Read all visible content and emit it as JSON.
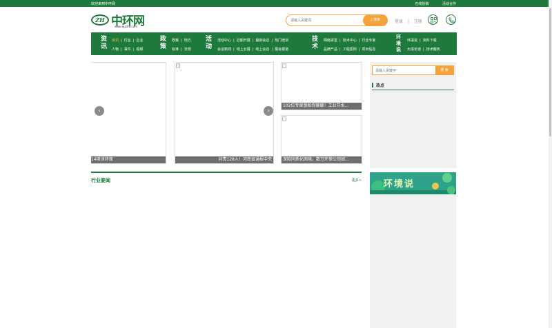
{
  "topbar": {
    "welcome": "欢迎来到中环网",
    "links": [
      "在线投稿",
      "活动合作"
    ]
  },
  "logo": {
    "badge": "ZH",
    "name": "中环网",
    "url": "www.epzhw.com"
  },
  "header": {
    "search_placeholder": "请输入关键词",
    "search_button": "搜索",
    "login": "登录",
    "divider": "|",
    "register": "注册",
    "icons": [
      "qr-code-icon",
      "phone-icon"
    ]
  },
  "nav": {
    "groups": [
      {
        "category": "资讯",
        "row1": [
          "资讯",
          "行业",
          "企业"
        ],
        "row2": [
          "人物",
          "事件",
          "视频"
        ]
      },
      {
        "category": "政策",
        "row1": [
          "政策",
          "地方"
        ],
        "row2": [
          "标准",
          "法规"
        ]
      },
      {
        "category": "活动",
        "row1": [
          "活动中心",
          "近期开展",
          "最新会议",
          "热门培训"
        ],
        "row2": [
          "会议新闻",
          "线上云展",
          "线上会议",
          "展会报道"
        ]
      },
      {
        "category": "技术",
        "row1": [
          "网络讲堂",
          "技术中心",
          "行业专家"
        ],
        "row2": [
          "品牌产品",
          "工程案例",
          "项目信息"
        ]
      },
      {
        "category": "环境说",
        "row1": [
          "环境说",
          "资料下载"
        ],
        "row2": [
          "大境论道",
          "技术服务"
        ]
      }
    ]
  },
  "carousel": {
    "captions": [
      "14项涉环保",
      "问责128人！河南省通报中央",
      "102位专家想和你聊聊！工业节水...",
      "深陷同质化困境。数万环保公司如..."
    ]
  },
  "sidebar": {
    "search_placeholder": "请输入关键字",
    "search_button": "搜 索",
    "hot_title": "热点",
    "banner_text": "环境说"
  },
  "news": {
    "title": "行业要闻",
    "more": "更多>"
  },
  "colors": {
    "brand_green": "#1e7a3c",
    "accent_orange": "#f5a23a",
    "highlight": "#f5c242"
  }
}
